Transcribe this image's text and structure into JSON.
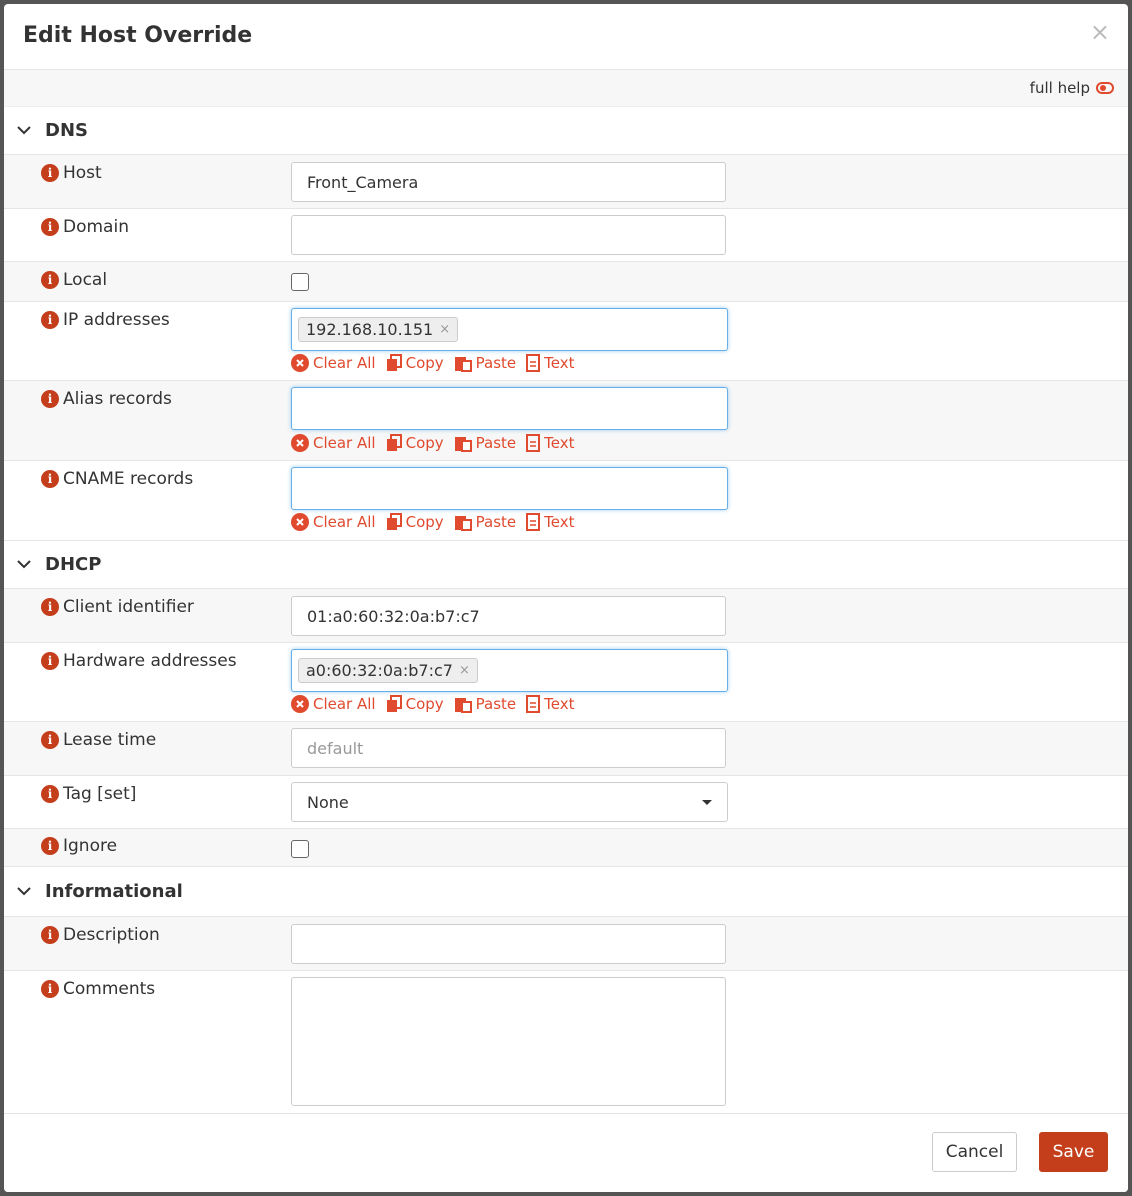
{
  "modal": {
    "title": "Edit Host Override",
    "close": "×"
  },
  "help": {
    "label": "full help"
  },
  "actions": {
    "clear_all": "Clear All",
    "copy": "Copy",
    "paste": "Paste",
    "text": "Text"
  },
  "sections": {
    "dns": {
      "title": "DNS",
      "host": {
        "label": "Host",
        "value": "Front_Camera"
      },
      "domain": {
        "label": "Domain",
        "value": ""
      },
      "local": {
        "label": "Local",
        "checked": false
      },
      "ip": {
        "label": "IP addresses",
        "tags": [
          "192.168.10.151"
        ]
      },
      "alias": {
        "label": "Alias records"
      },
      "cname": {
        "label": "CNAME records"
      }
    },
    "dhcp": {
      "title": "DHCP",
      "client_id": {
        "label": "Client identifier",
        "value": "01:a0:60:32:0a:b7:c7"
      },
      "hw": {
        "label": "Hardware addresses",
        "tags": [
          "a0:60:32:0a:b7:c7"
        ]
      },
      "lease": {
        "label": "Lease time",
        "placeholder": "default"
      },
      "tag": {
        "label": "Tag [set]",
        "value": "None"
      },
      "ignore": {
        "label": "Ignore",
        "checked": false
      }
    },
    "info": {
      "title": "Informational",
      "description": {
        "label": "Description",
        "value": ""
      },
      "comments": {
        "label": "Comments",
        "value": ""
      }
    }
  },
  "footer": {
    "cancel": "Cancel",
    "save": "Save"
  },
  "colors": {
    "accent": "#c43e1c",
    "link": "#e04a2f",
    "focus": "#66afe9"
  }
}
